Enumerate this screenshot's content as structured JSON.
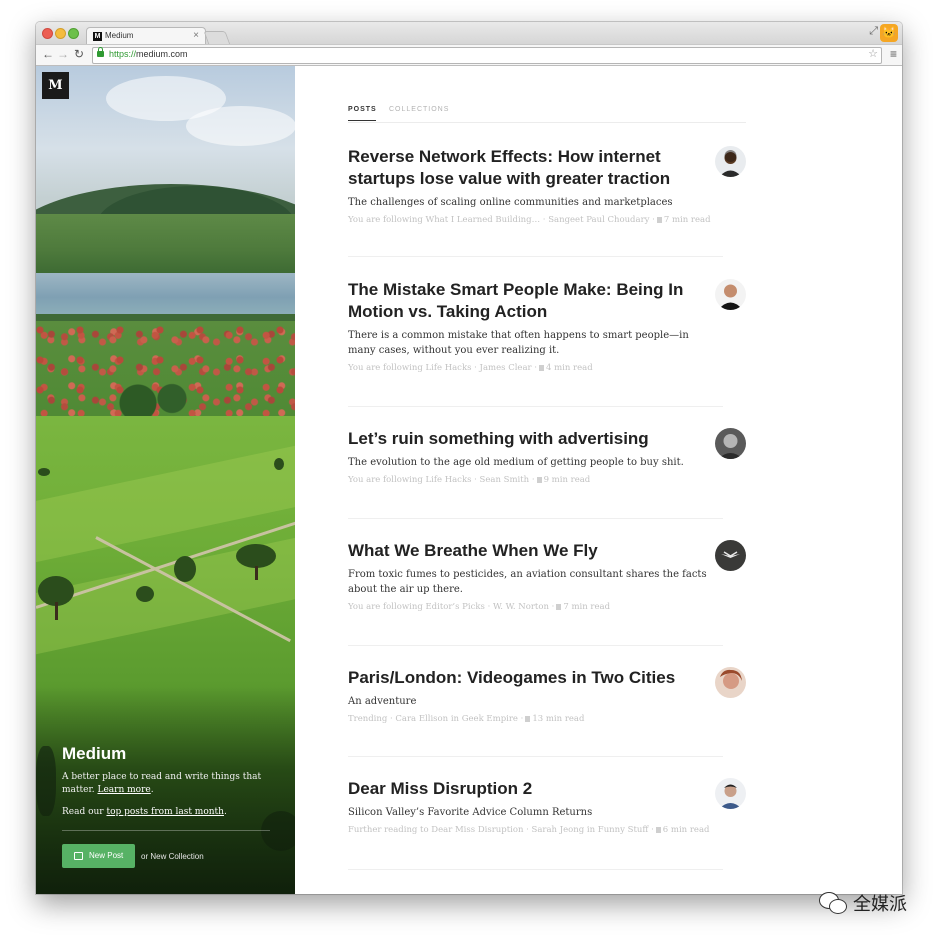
{
  "browser": {
    "tab_title": "Medium",
    "tab_close": "×",
    "url_scheme": "https://",
    "url_host": "medium.com",
    "favicon_letter": "M",
    "icons": [
      "back-icon",
      "forward-icon",
      "reload-icon",
      "lock-icon",
      "star-icon",
      "menu-icon"
    ]
  },
  "sidebar": {
    "logo": "M",
    "title": "Medium",
    "tagline_prefix": "A better place to read and write things that matter. ",
    "learn_more": "Learn more",
    "tagline_suffix": ".",
    "read_prefix": "Read our ",
    "top_posts_link": "top posts from last month",
    "read_suffix": ".",
    "new_post_label": "New Post",
    "new_collection_text": "or New Collection",
    "button_color": "#57b265"
  },
  "tabs": {
    "posts": "POSTS",
    "collections": "COLLECTIONS"
  },
  "posts": [
    {
      "title": "Reverse Network Effects: How internet startups lose value with greater traction",
      "subtitle": "The challenges of scaling online communities and marketplaces",
      "meta": "You are following What I Learned Building… · Sangeet Paul Choudary ·",
      "read_time": "7 min read"
    },
    {
      "title": "The Mistake Smart People Make: Being In Motion vs. Taking Action",
      "subtitle": "There is a common mistake that often happens to smart people—in many cases, without you ever realizing it.",
      "meta": "You are following Life Hacks · James Clear ·",
      "read_time": "4 min read"
    },
    {
      "title": "Let’s ruin something with advertising",
      "subtitle": "The evolution to the age old medium of getting people to buy shit.",
      "meta": "You are following Life Hacks · Sean Smith ·",
      "read_time": "9 min read"
    },
    {
      "title": "What We Breathe When We Fly",
      "subtitle": "From toxic fumes to pesticides, an aviation consultant shares the facts about the air up there.",
      "meta": "You are following Editor’s Picks · W. W. Norton ·",
      "read_time": "7 min read"
    },
    {
      "title": "Paris/London: Videogames in Two Cities",
      "subtitle": "An adventure",
      "meta": "Trending · Cara Ellison in Geek Empire ·",
      "read_time": "13 min read"
    },
    {
      "title": "Dear Miss Disruption 2",
      "subtitle": "Silicon Valley’s Favorite Advice Column Returns",
      "meta": "Further reading to Dear Miss Disruption · Sarah Jeong in Funny Stuff ·",
      "read_time": "6 min read"
    }
  ],
  "watermark": {
    "text": "全媒派"
  }
}
